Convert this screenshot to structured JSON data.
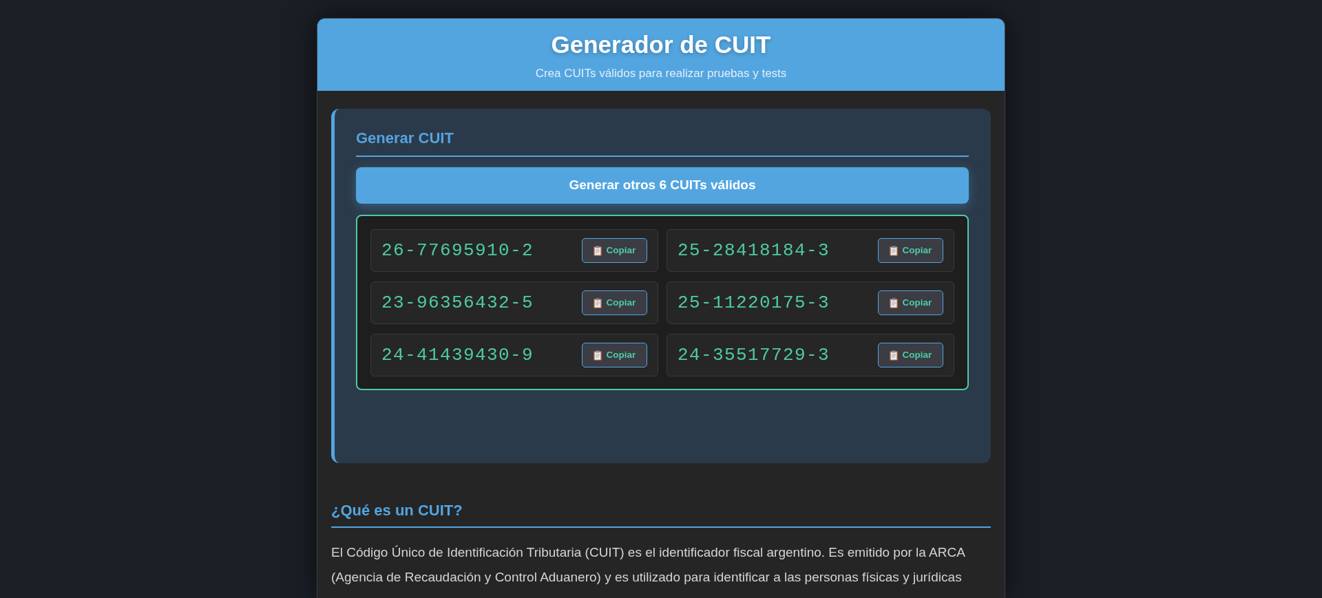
{
  "header": {
    "title": "Generador de CUIT",
    "subtitle": "Crea CUITs válidos para realizar pruebas y tests"
  },
  "generator": {
    "heading": "Generar CUIT",
    "button": "Generar otros 6 CUITs válidos",
    "results": [
      {
        "cuit": "26-77695910-2",
        "copy_label": "Copiar"
      },
      {
        "cuit": "25-28418184-3",
        "copy_label": "Copiar"
      },
      {
        "cuit": "23-96356432-5",
        "copy_label": "Copiar"
      },
      {
        "cuit": "25-11220175-3",
        "copy_label": "Copiar"
      },
      {
        "cuit": "24-41439430-9",
        "copy_label": "Copiar"
      },
      {
        "cuit": "24-35517729-3",
        "copy_label": "Copiar"
      }
    ]
  },
  "info": {
    "heading": "¿Qué es un CUIT?",
    "paragraph": "El Código Único de Identificación Tributaria (CUIT) es el identificador fiscal argentino. Es emitido por la ARCA (Agencia de Recaudación y Control Aduanero) y es utilizado para identificar a las personas físicas y jurídicas"
  }
}
